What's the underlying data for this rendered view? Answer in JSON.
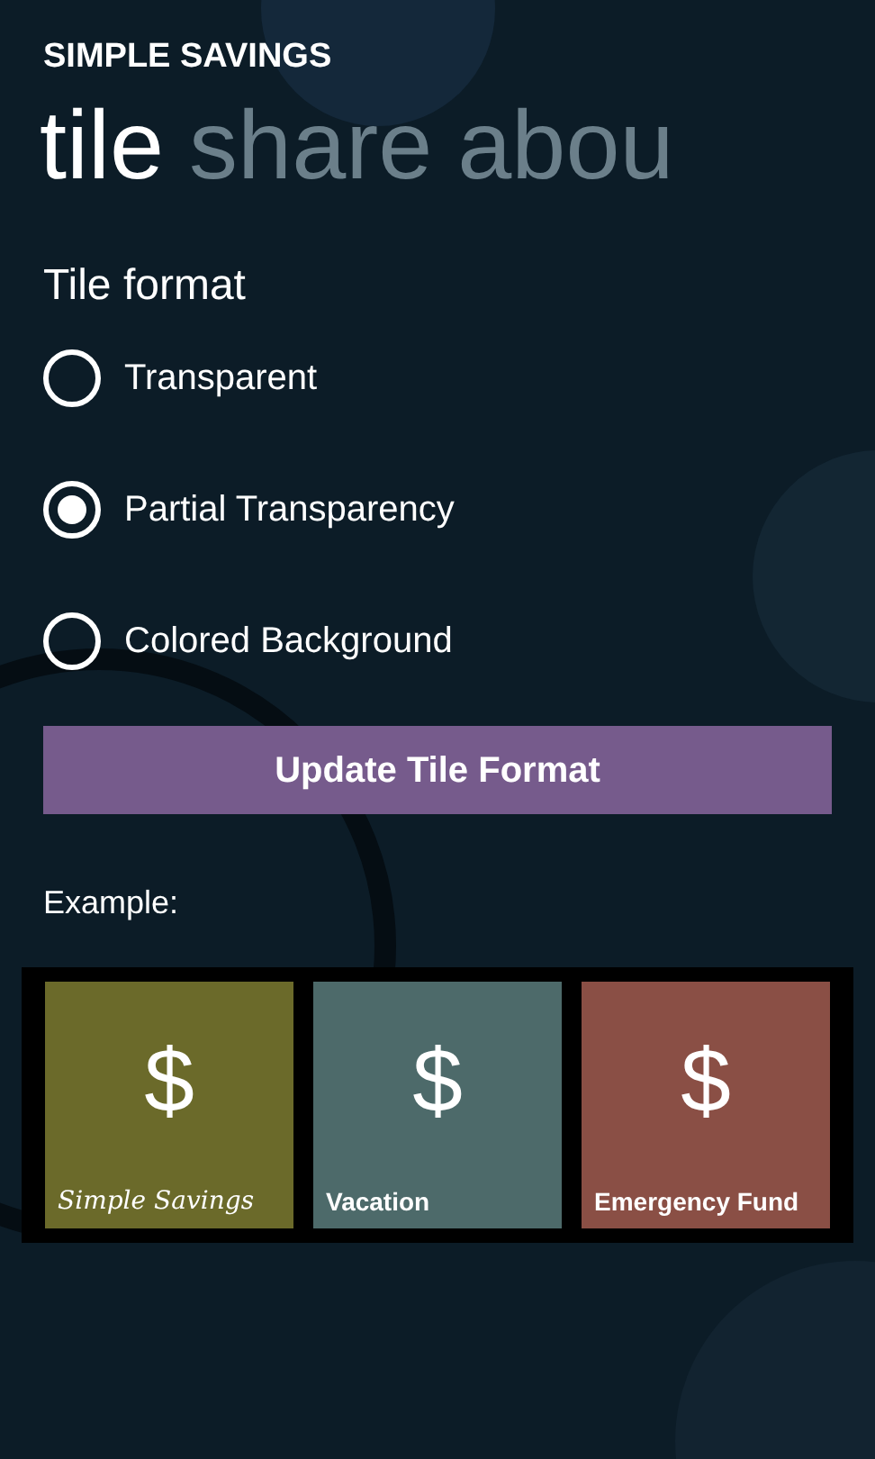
{
  "app_title": "SIMPLE SAVINGS",
  "pivot_tabs": [
    {
      "label": "tile",
      "selected": true
    },
    {
      "label": "share",
      "selected": false
    },
    {
      "label": "abou",
      "selected": false
    }
  ],
  "section_title": "Tile format",
  "tile_format_options": [
    {
      "label": "Transparent",
      "selected": false
    },
    {
      "label": "Partial Transparency",
      "selected": true
    },
    {
      "label": "Colored Background",
      "selected": false
    }
  ],
  "update_button": "Update Tile Format",
  "example_label": "Example:",
  "example_tiles": [
    {
      "symbol": "$",
      "label": "Simple Savings",
      "kind": "script",
      "color": "#6b6a2a"
    },
    {
      "symbol": "$",
      "label": "Vacation",
      "kind": "plain",
      "color": "#4d6a6a"
    },
    {
      "symbol": "$",
      "label": "Emergency Fund",
      "kind": "plain",
      "color": "#8a4f45"
    }
  ]
}
